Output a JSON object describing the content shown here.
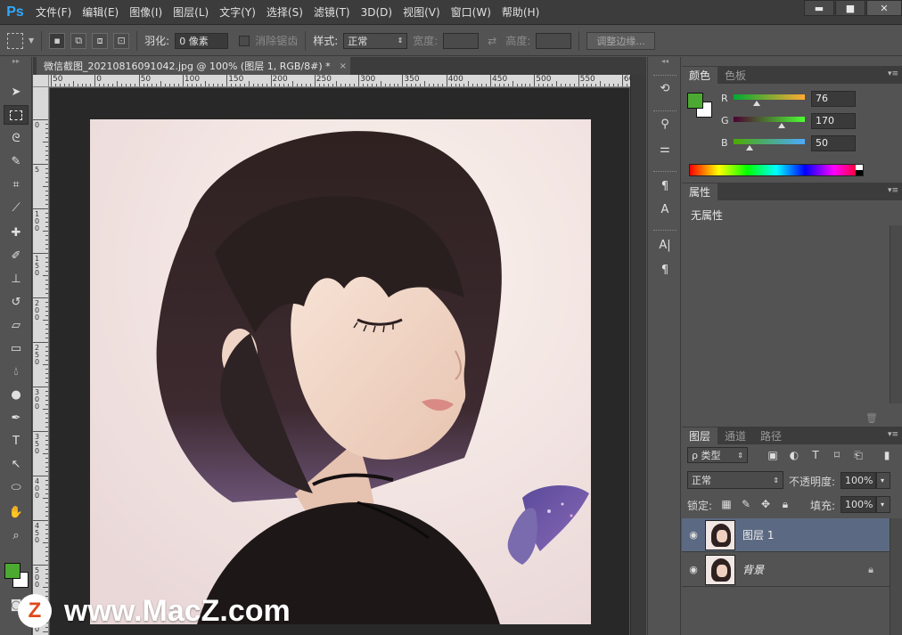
{
  "app": {
    "logo": "Ps"
  },
  "menu": [
    "文件(F)",
    "编辑(E)",
    "图像(I)",
    "图层(L)",
    "文字(Y)",
    "选择(S)",
    "滤镜(T)",
    "3D(D)",
    "视图(V)",
    "窗口(W)",
    "帮助(H)"
  ],
  "window_controls": {
    "minimize": "▬",
    "maximize": "■",
    "close": "✕"
  },
  "options": {
    "feather_label": "羽化:",
    "feather_value": "0 像素",
    "antialias_label": "消除锯齿",
    "style_label": "样式:",
    "style_value": "正常",
    "width_label": "宽度:",
    "height_label": "高度:",
    "refine_edge": "调整边缘..."
  },
  "document": {
    "tab_title": "微信截图_20210816091042.jpg @ 100% (图层 1, RGB/8#) *",
    "close": "×",
    "ruler_top": [
      "50",
      "0",
      "50",
      "100",
      "150",
      "200",
      "250",
      "300",
      "350",
      "400",
      "450",
      "500",
      "550",
      "60"
    ],
    "ruler_left": [
      "0",
      "5",
      "1 0 0",
      "1 5 0",
      "2 0 0",
      "2 5 0",
      "3 0 0",
      "3 5 0",
      "4 0 0",
      "4 5 0",
      "5 0 0",
      "5 5 0"
    ]
  },
  "color_panel": {
    "tabs": [
      "颜色",
      "色板"
    ],
    "r_label": "R",
    "g_label": "G",
    "b_label": "B",
    "r": "76",
    "g": "170",
    "b": "50",
    "foreground": "#4caa32",
    "background": "#ffffff"
  },
  "properties_panel": {
    "tab": "属性",
    "empty_text": "无属性"
  },
  "layers_panel": {
    "tabs": [
      "图层",
      "通道",
      "路径"
    ],
    "filter_label": "ρ 类型",
    "blend_mode": "正常",
    "opacity_label": "不透明度:",
    "opacity_value": "100%",
    "lock_label": "锁定:",
    "fill_label": "填充:",
    "fill_value": "100%",
    "layers": [
      {
        "name": "图层 1",
        "selected": true
      },
      {
        "name": "背景",
        "selected": false,
        "locked": true
      }
    ]
  },
  "watermark": {
    "logo_letter": "Z",
    "text": "www.MacZ.com"
  }
}
